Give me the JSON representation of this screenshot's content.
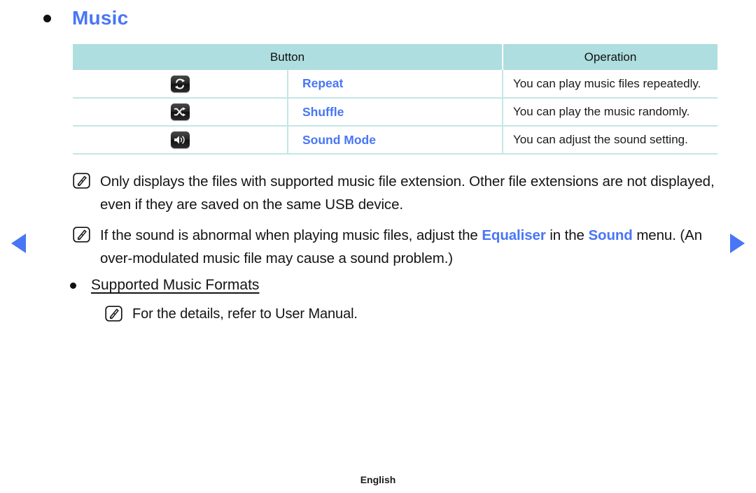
{
  "page": {
    "section_bullet_icon": "bullet-dot-icon",
    "title": "Music",
    "footer_label": "English"
  },
  "navigation": {
    "prev_icon": "triangle-left-icon",
    "next_icon": "triangle-right-icon",
    "accent_color": "#4876F5"
  },
  "colors": {
    "header_bg": "#AEDEDF",
    "row_divider": "#C3E6E6",
    "link_blue": "#4876F5",
    "body_text": "#141414"
  },
  "table": {
    "headers": [
      "Button",
      "Operation"
    ],
    "rows": [
      {
        "icon_name": "repeat-icon",
        "button": "Repeat",
        "operation": "You can play music files repeatedly."
      },
      {
        "icon_name": "shuffle-icon",
        "button": "Shuffle",
        "operation": "You can play the music randomly."
      },
      {
        "icon_name": "sound-mode-speaker-icon",
        "button": "Sound Mode",
        "operation": "You can adjust the sound setting."
      }
    ]
  },
  "notes": [
    {
      "icon_name": "note-pencil-icon",
      "text": "Only displays the files with supported music file extension. Other file extensions are not displayed, even if they are saved on the same USB device."
    },
    {
      "icon_name": "note-pencil-icon",
      "part1": "If the sound is abnormal when playing music files, adjust the ",
      "highlight1": "Equaliser",
      "part2": " in the ",
      "highlight2": "Sound",
      "part3": " menu. (An over-modulated music file may cause a sound problem.)"
    },
    {
      "icon_name": "note-pencil-icon",
      "text": "For the details, refer to User Manual."
    }
  ],
  "supported_formats": {
    "bullet_icon": "bullet-dot-icon",
    "label": "Supported Music Formats"
  }
}
